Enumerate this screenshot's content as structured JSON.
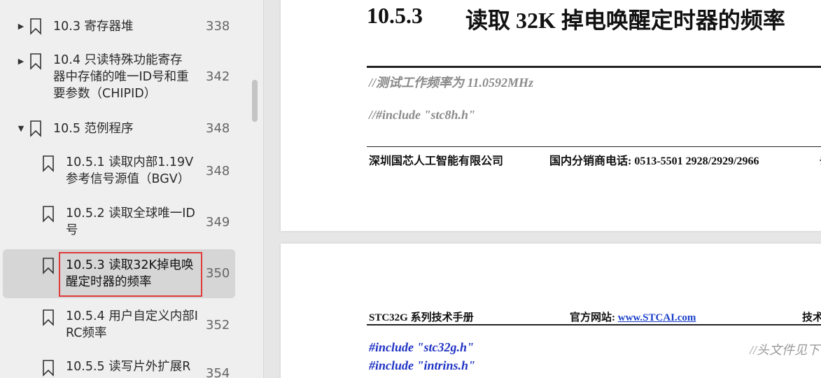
{
  "sidebar": {
    "items": [
      {
        "label_lines": [
          "10.3  寄存器堆"
        ],
        "page": "338",
        "expand": "collapsed"
      },
      {
        "label_lines": [
          "10.4  只读特殊功能寄存",
          "器中存储的唯一ID号和重",
          "要参数（CHIPID）"
        ],
        "page": "342",
        "expand": "collapsed"
      },
      {
        "label_lines": [
          "10.5  范例程序"
        ],
        "page": "348",
        "expand": "expanded"
      },
      {
        "label_lines": [
          "10.5.1 读取内部1.19V",
          "参考信号源值（BGV）"
        ],
        "page": "348",
        "expand": "none"
      },
      {
        "label_lines": [
          "10.5.2 读取全球唯一ID",
          "号"
        ],
        "page": "349",
        "expand": "none"
      },
      {
        "label_lines": [
          "10.5.3 读取32K掉电唤",
          "醒定时器的频率"
        ],
        "page": "350",
        "expand": "none",
        "selected": true
      },
      {
        "label_lines": [
          "10.5.4 用户自定义内部I",
          "RC频率"
        ],
        "page": "352",
        "expand": "none"
      },
      {
        "label_lines": [
          "10.5.5 读写片外扩展R"
        ],
        "page": "354",
        "expand": "none"
      }
    ]
  },
  "icons": {
    "collapsed": "triangle-right-icon",
    "expanded": "triangle-down-icon",
    "bookmark": "bookmark-icon"
  },
  "colors": {
    "highlight_border": "#e03a3a",
    "selected_bg": "#d6d6d6",
    "code_blue": "#1f33c4",
    "link_blue": "#1a3fc9"
  },
  "page1": {
    "heading_number": "10.5.3",
    "heading_title": "读取 32K 掉电唤醒定时器的频率",
    "comment1": "//测试工作频率为 11.0592MHz",
    "comment2": "//#include \"stc8h.h\"",
    "footer_company": "深圳国芯人工智能有限公司",
    "footer_phone": "国内分销商电话: 0513-5501 2928/2929/2966",
    "footer_cut": "去"
  },
  "page2": {
    "header_manual": "STC32G 系列技术手册",
    "header_site_label": "官方网站: ",
    "header_site_link": "www.STCAI.com",
    "header_cut": "技术",
    "code_line1": "#include \"stc32g.h\"",
    "code_line1_comment": "//头文件见下",
    "code_line2": "#include \"intrins.h\""
  }
}
